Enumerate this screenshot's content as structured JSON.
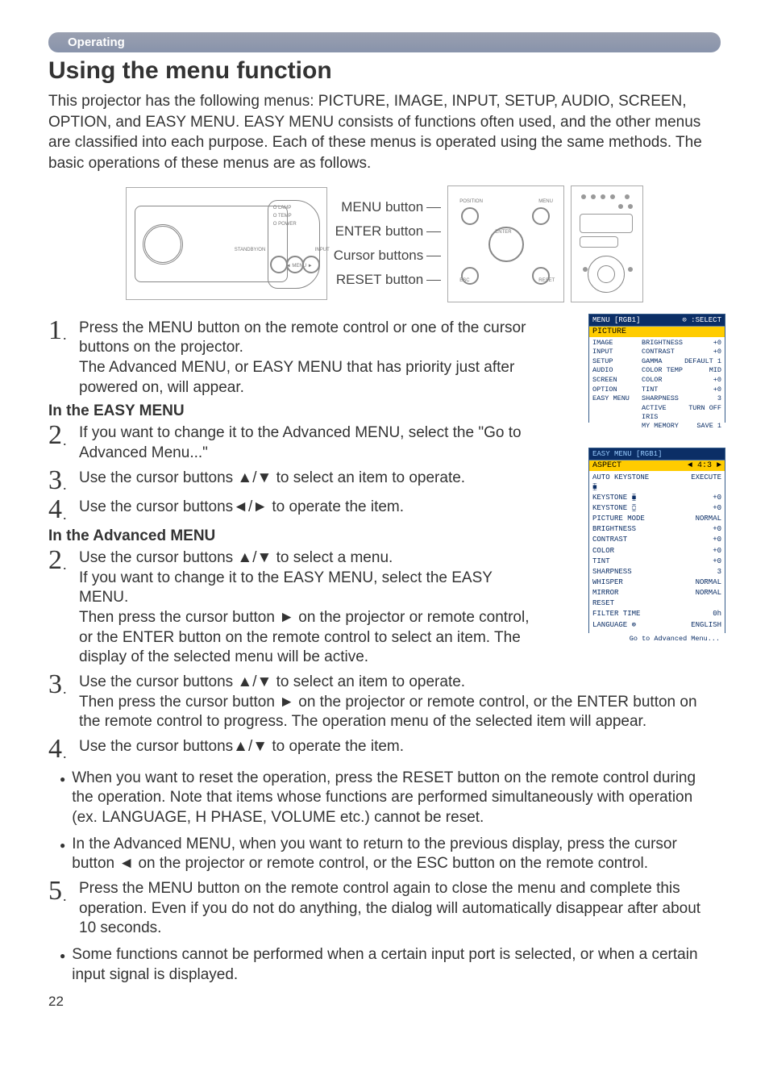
{
  "header": {
    "section": "Operating"
  },
  "title": "Using the menu function",
  "intro": "This projector has the following menus: PICTURE, IMAGE, INPUT, SETUP, AUDIO, SCREEN, OPTION, and EASY MENU. EASY MENU consists of functions often used, and the other menus are classified into each purpose. Each of these menus is operated using the same methods. The basic operations of these menus are as follows.",
  "panel_labels": {
    "menu": "MENU button",
    "enter": "ENTER button",
    "cursor": "Cursor buttons",
    "reset": "RESET button"
  },
  "steps": {
    "s1": "Press the MENU button on the remote control or one of the cursor buttons on the projector.",
    "s1b": "The Advanced MENU, or EASY MENU that has priority just after powered on, will appear.",
    "easy_head": "In the EASY MENU",
    "e2": "If you want to change it to the Advanced MENU, select the \"Go to Advanced Menu...\"",
    "e3": "Use the cursor buttons ▲/▼ to select an item to operate.",
    "e4": "Use the cursor buttons◄/► to operate the item.",
    "adv_head": "In the Advanced MENU",
    "a2": "Use the cursor buttons ▲/▼ to select a menu.",
    "a2b": "If you want to change it to the EASY MENU, select the EASY MENU.",
    "a2c": "Then press the cursor button ► on the projector or remote control, or the ENTER button on the remote control to select an item. The display of the selected menu will be active.",
    "a3": "Use the cursor buttons ▲/▼ to select an item to operate.",
    "a3b": "Then press the cursor button ► on the projector or remote control, or the ENTER button on the remote control to progress. The operation menu of the selected item will appear.",
    "a4": "Use the cursor buttons▲/▼ to operate the item."
  },
  "bullets": {
    "b1": "When you want to reset the operation, press the RESET button on the remote control during the operation. Note that items whose functions are performed simultaneously with operation (ex. LANGUAGE, H PHASE, VOLUME etc.) cannot be reset.",
    "b2": "In the Advanced MENU, when you want to return to the previous display, press the cursor button ◄ on the projector or remote control, or the ESC button on the remote control."
  },
  "step5": "Press the MENU button on the remote control again to close the menu and complete this operation. Even if you do not do anything, the dialog will automatically disappear after about 10 seconds.",
  "bullet3": "Some functions cannot be performed when a certain input port is selected, or when a certain input signal is displayed.",
  "page_number": "22",
  "osd_adv": {
    "title_left": "MENU [RGB1]",
    "title_right": "⊙ :SELECT",
    "highlight": "PICTURE",
    "left": [
      "IMAGE",
      "INPUT",
      "SETUP",
      "AUDIO",
      "SCREEN",
      "OPTION",
      "EASY MENU"
    ],
    "mid": [
      "BRIGHTNESS",
      "CONTRAST",
      "GAMMA",
      "COLOR TEMP",
      "COLOR",
      "TINT",
      "SHARPNESS",
      "ACTIVE IRIS",
      "MY MEMORY"
    ],
    "right": [
      "+0",
      "+0",
      "DEFAULT 1",
      "MID",
      "+0",
      "+0",
      "3",
      "TURN OFF",
      "SAVE 1"
    ]
  },
  "osd_easy": {
    "title": "EASY MENU [RGB1]",
    "hi_left": "ASPECT",
    "hi_right": "◄   4:3   ►",
    "rows": [
      [
        "AUTO KEYSTONE ⧯",
        "EXECUTE"
      ],
      [
        "KEYSTONE  ⧯",
        "+0"
      ],
      [
        "KEYSTONE  ⧮",
        "+0"
      ],
      [
        "PICTURE MODE",
        "NORMAL"
      ],
      [
        "BRIGHTNESS",
        "+0"
      ],
      [
        "CONTRAST",
        "+0"
      ],
      [
        "COLOR",
        "+0"
      ],
      [
        "TINT",
        "+0"
      ],
      [
        "SHARPNESS",
        "3"
      ],
      [
        "WHISPER",
        "NORMAL"
      ],
      [
        "MIRROR",
        "NORMAL"
      ],
      [
        "RESET",
        ""
      ],
      [
        "FILTER TIME",
        "0h"
      ],
      [
        "LANGUAGE   ⊚",
        "ENGLISH"
      ]
    ],
    "footer": "Go to Advanced Menu..."
  }
}
